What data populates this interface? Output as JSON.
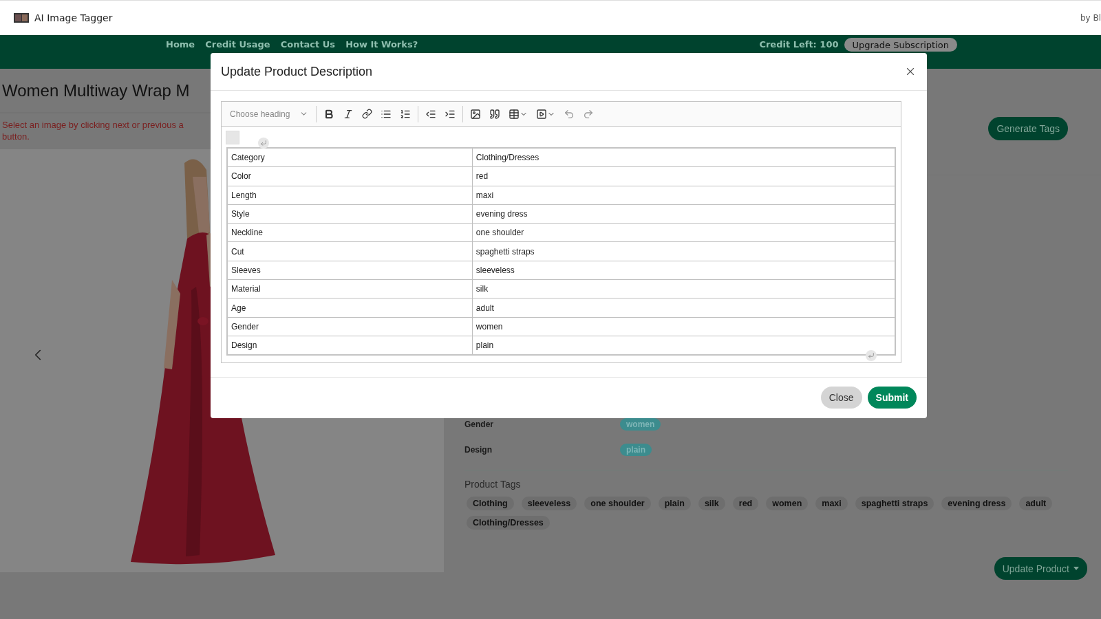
{
  "app": {
    "title": "AI Image Tagger",
    "byline": "by Bl"
  },
  "nav": {
    "links": [
      "Home",
      "Credit Usage",
      "Contact Us",
      "How It Works?"
    ],
    "credit_label": "Credit Left:",
    "credit_value": "100",
    "upgrade_button": "Upgrade Subscription"
  },
  "product": {
    "title": "Women Multiway Wrap M",
    "hint_lines": [
      "Select an image by clicking next or previous a",
      "button."
    ]
  },
  "generate_button": "Generate Tags",
  "attributes": [
    {
      "name": "Gender",
      "value": "women"
    },
    {
      "name": "Design",
      "value": "plain"
    }
  ],
  "tags_heading": "Product Tags",
  "tags": [
    "Clothing",
    "sleeveless",
    "one shoulder",
    "plain",
    "silk",
    "red",
    "women",
    "maxi",
    "spaghetti straps",
    "evening dress",
    "adult",
    "Clothing/Dresses"
  ],
  "update_button": "Update Product",
  "modal": {
    "title": "Update Product Description",
    "heading_placeholder": "Choose heading",
    "rows": [
      {
        "key": "Category",
        "value": "Clothing/Dresses"
      },
      {
        "key": "Color",
        "value": "red"
      },
      {
        "key": "Length",
        "value": "maxi"
      },
      {
        "key": "Style",
        "value": "evening dress"
      },
      {
        "key": "Neckline",
        "value": "one shoulder"
      },
      {
        "key": "Cut",
        "value": "spaghetti straps"
      },
      {
        "key": "Sleeves",
        "value": "sleeveless"
      },
      {
        "key": "Material",
        "value": "silk"
      },
      {
        "key": "Age",
        "value": "adult"
      },
      {
        "key": "Gender",
        "value": "women"
      },
      {
        "key": "Design",
        "value": "plain"
      }
    ],
    "buttons": [
      {
        "label": "Close",
        "kind": "secondary"
      },
      {
        "label": "Submit",
        "kind": "primary"
      }
    ]
  }
}
